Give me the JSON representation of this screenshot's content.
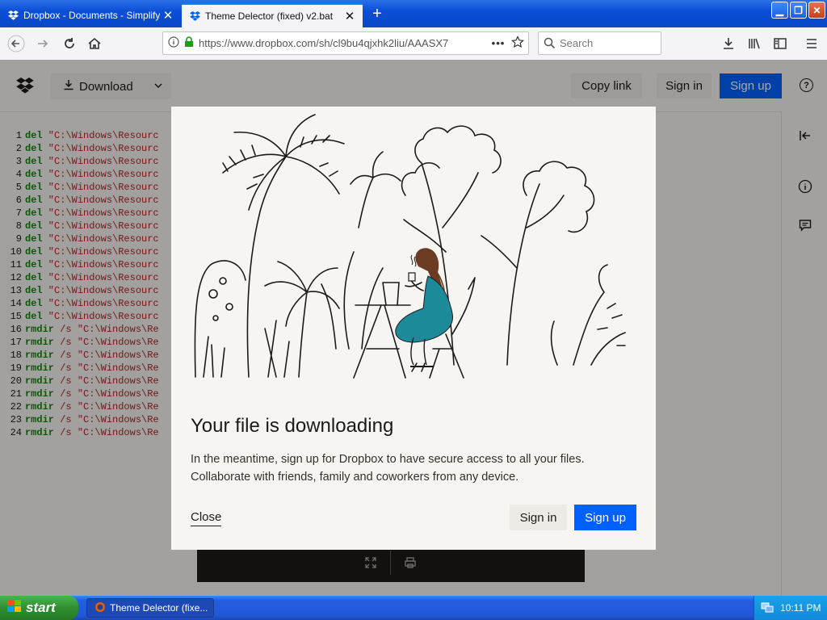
{
  "browser": {
    "tabs": [
      {
        "title": "Dropbox - Documents - Simplify yo",
        "active": false
      },
      {
        "title": "Theme Delector (fixed) v2.bat",
        "active": true
      }
    ],
    "url": "https://www.dropbox.com/sh/cl9bu4qjxhk2liu/AAASX7",
    "search_placeholder": "Search"
  },
  "toolbar": {
    "download_label": "Download",
    "copy_link_label": "Copy link",
    "sign_in_label": "Sign in",
    "sign_up_label": "Sign up",
    "help_label": "?"
  },
  "code": {
    "lines": [
      {
        "n": "1",
        "cmd": "del",
        "args": " \"C:\\Windows\\Resourc"
      },
      {
        "n": "2",
        "cmd": "del",
        "args": " \"C:\\Windows\\Resourc"
      },
      {
        "n": "3",
        "cmd": "del",
        "args": " \"C:\\Windows\\Resourc"
      },
      {
        "n": "4",
        "cmd": "del",
        "args": " \"C:\\Windows\\Resourc"
      },
      {
        "n": "5",
        "cmd": "del",
        "args": " \"C:\\Windows\\Resourc"
      },
      {
        "n": "6",
        "cmd": "del",
        "args": " \"C:\\Windows\\Resourc"
      },
      {
        "n": "7",
        "cmd": "del",
        "args": " \"C:\\Windows\\Resourc"
      },
      {
        "n": "8",
        "cmd": "del",
        "args": " \"C:\\Windows\\Resourc"
      },
      {
        "n": "9",
        "cmd": "del",
        "args": " \"C:\\Windows\\Resourc"
      },
      {
        "n": "10",
        "cmd": "del",
        "args": " \"C:\\Windows\\Resourc"
      },
      {
        "n": "11",
        "cmd": "del",
        "args": " \"C:\\Windows\\Resourc"
      },
      {
        "n": "12",
        "cmd": "del",
        "args": " \"C:\\Windows\\Resourc"
      },
      {
        "n": "13",
        "cmd": "del",
        "args": " \"C:\\Windows\\Resourc"
      },
      {
        "n": "14",
        "cmd": "del",
        "args": " \"C:\\Windows\\Resourc"
      },
      {
        "n": "15",
        "cmd": "del",
        "args": " \"C:\\Windows\\Resourc"
      },
      {
        "n": "16",
        "cmd": "rmdir",
        "args": " /s \"C:\\Windows\\Re"
      },
      {
        "n": "17",
        "cmd": "rmdir",
        "args": " /s \"C:\\Windows\\Re"
      },
      {
        "n": "18",
        "cmd": "rmdir",
        "args": " /s \"C:\\Windows\\Re"
      },
      {
        "n": "19",
        "cmd": "rmdir",
        "args": " /s \"C:\\Windows\\Re"
      },
      {
        "n": "20",
        "cmd": "rmdir",
        "args": " /s \"C:\\Windows\\Re"
      },
      {
        "n": "21",
        "cmd": "rmdir",
        "args": " /s \"C:\\Windows\\Re"
      },
      {
        "n": "22",
        "cmd": "rmdir",
        "args": " /s \"C:\\Windows\\Re"
      },
      {
        "n": "23",
        "cmd": "rmdir",
        "args": " /s \"C:\\Windows\\Re"
      },
      {
        "n": "24",
        "cmd": "rmdir",
        "args": " /s \"C:\\Windows\\Re"
      }
    ]
  },
  "modal": {
    "title": "Your file is downloading",
    "body": "In the meantime, sign up for Dropbox to have secure access to all your files. Collaborate with friends, family and coworkers from any device.",
    "close_label": "Close",
    "sign_in_label": "Sign in",
    "sign_up_label": "Sign up"
  },
  "taskbar": {
    "start_label": "start",
    "task_item": "Theme Delector (fixe...",
    "clock": "10:11 PM"
  },
  "icons": [
    "dropbox-icon",
    "download-icon",
    "chevron-down-icon",
    "help-icon",
    "collapse-panel-icon",
    "info-icon",
    "comment-icon",
    "expand-icon",
    "print-icon",
    "back-icon",
    "forward-icon",
    "reload-icon",
    "home-icon",
    "lock-icon",
    "star-icon",
    "search-icon",
    "library-icon",
    "sidebar-icon",
    "menu-icon"
  ],
  "colors": {
    "accent": "#0061fe",
    "titlebar": "#0b4fd6",
    "taskbar": "#245ee0",
    "start": "#2f8f2f",
    "keyword": "#0b8a0b",
    "string": "#b22222",
    "woman_dress": "#1d8a99"
  }
}
